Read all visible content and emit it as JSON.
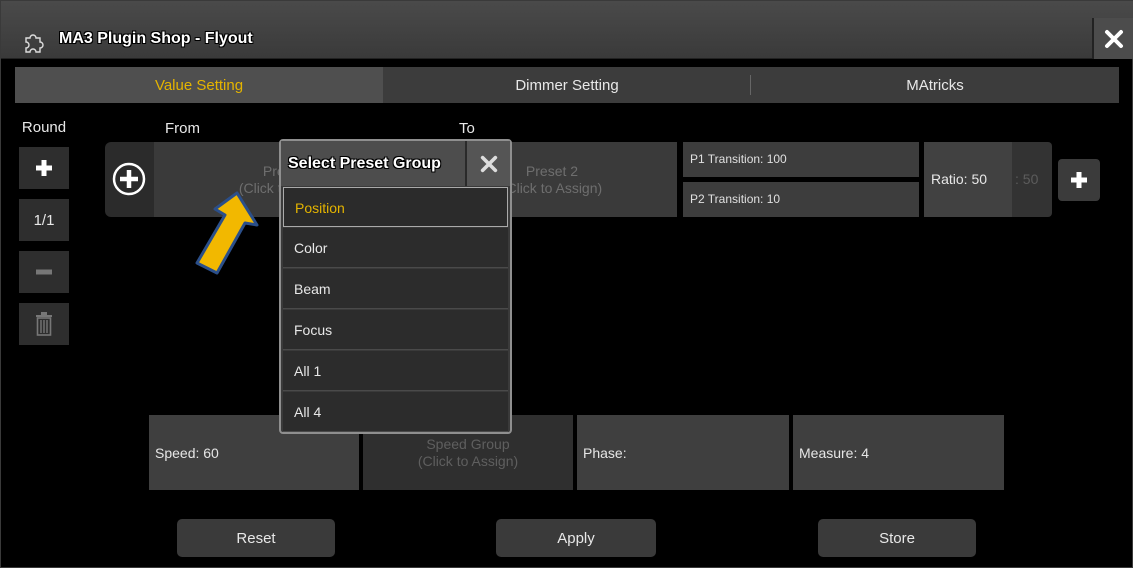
{
  "window": {
    "title": "MA3 Plugin Shop - Flyout"
  },
  "tabs": [
    {
      "label": "Value Setting",
      "active": true
    },
    {
      "label": "Dimmer Setting",
      "active": false
    },
    {
      "label": "MAtricks",
      "active": false
    }
  ],
  "left_toolbar": {
    "label": "Round",
    "counter": "1/1"
  },
  "labels": {
    "from": "From",
    "to": "To"
  },
  "presets": {
    "from_line1": "Preset 1",
    "from_line2": "(Click to Assign)",
    "to_line1": "Preset 2",
    "to_line2": "(Click to Assign)"
  },
  "transitions": {
    "p1": "P1 Transition: 100",
    "p2": "P2 Transition: 10"
  },
  "ratio": {
    "label": "Ratio: 50",
    "value": ": 50"
  },
  "speed_row": {
    "speed": "Speed: 60",
    "group_line1": "Speed Group",
    "group_line2": "(Click to Assign)",
    "phase": "Phase:",
    "measure": "Measure: 4"
  },
  "buttons": {
    "reset": "Reset",
    "apply": "Apply",
    "store": "Store"
  },
  "popup": {
    "title": "Select Preset Group",
    "options": [
      "Position",
      "Color",
      "Beam",
      "Focus",
      "All 1",
      "All 4"
    ],
    "selected": "Position"
  },
  "colors": {
    "accent": "#e4b400",
    "arrow_fill": "#f2b800",
    "arrow_outline": "#2b4f8a"
  }
}
